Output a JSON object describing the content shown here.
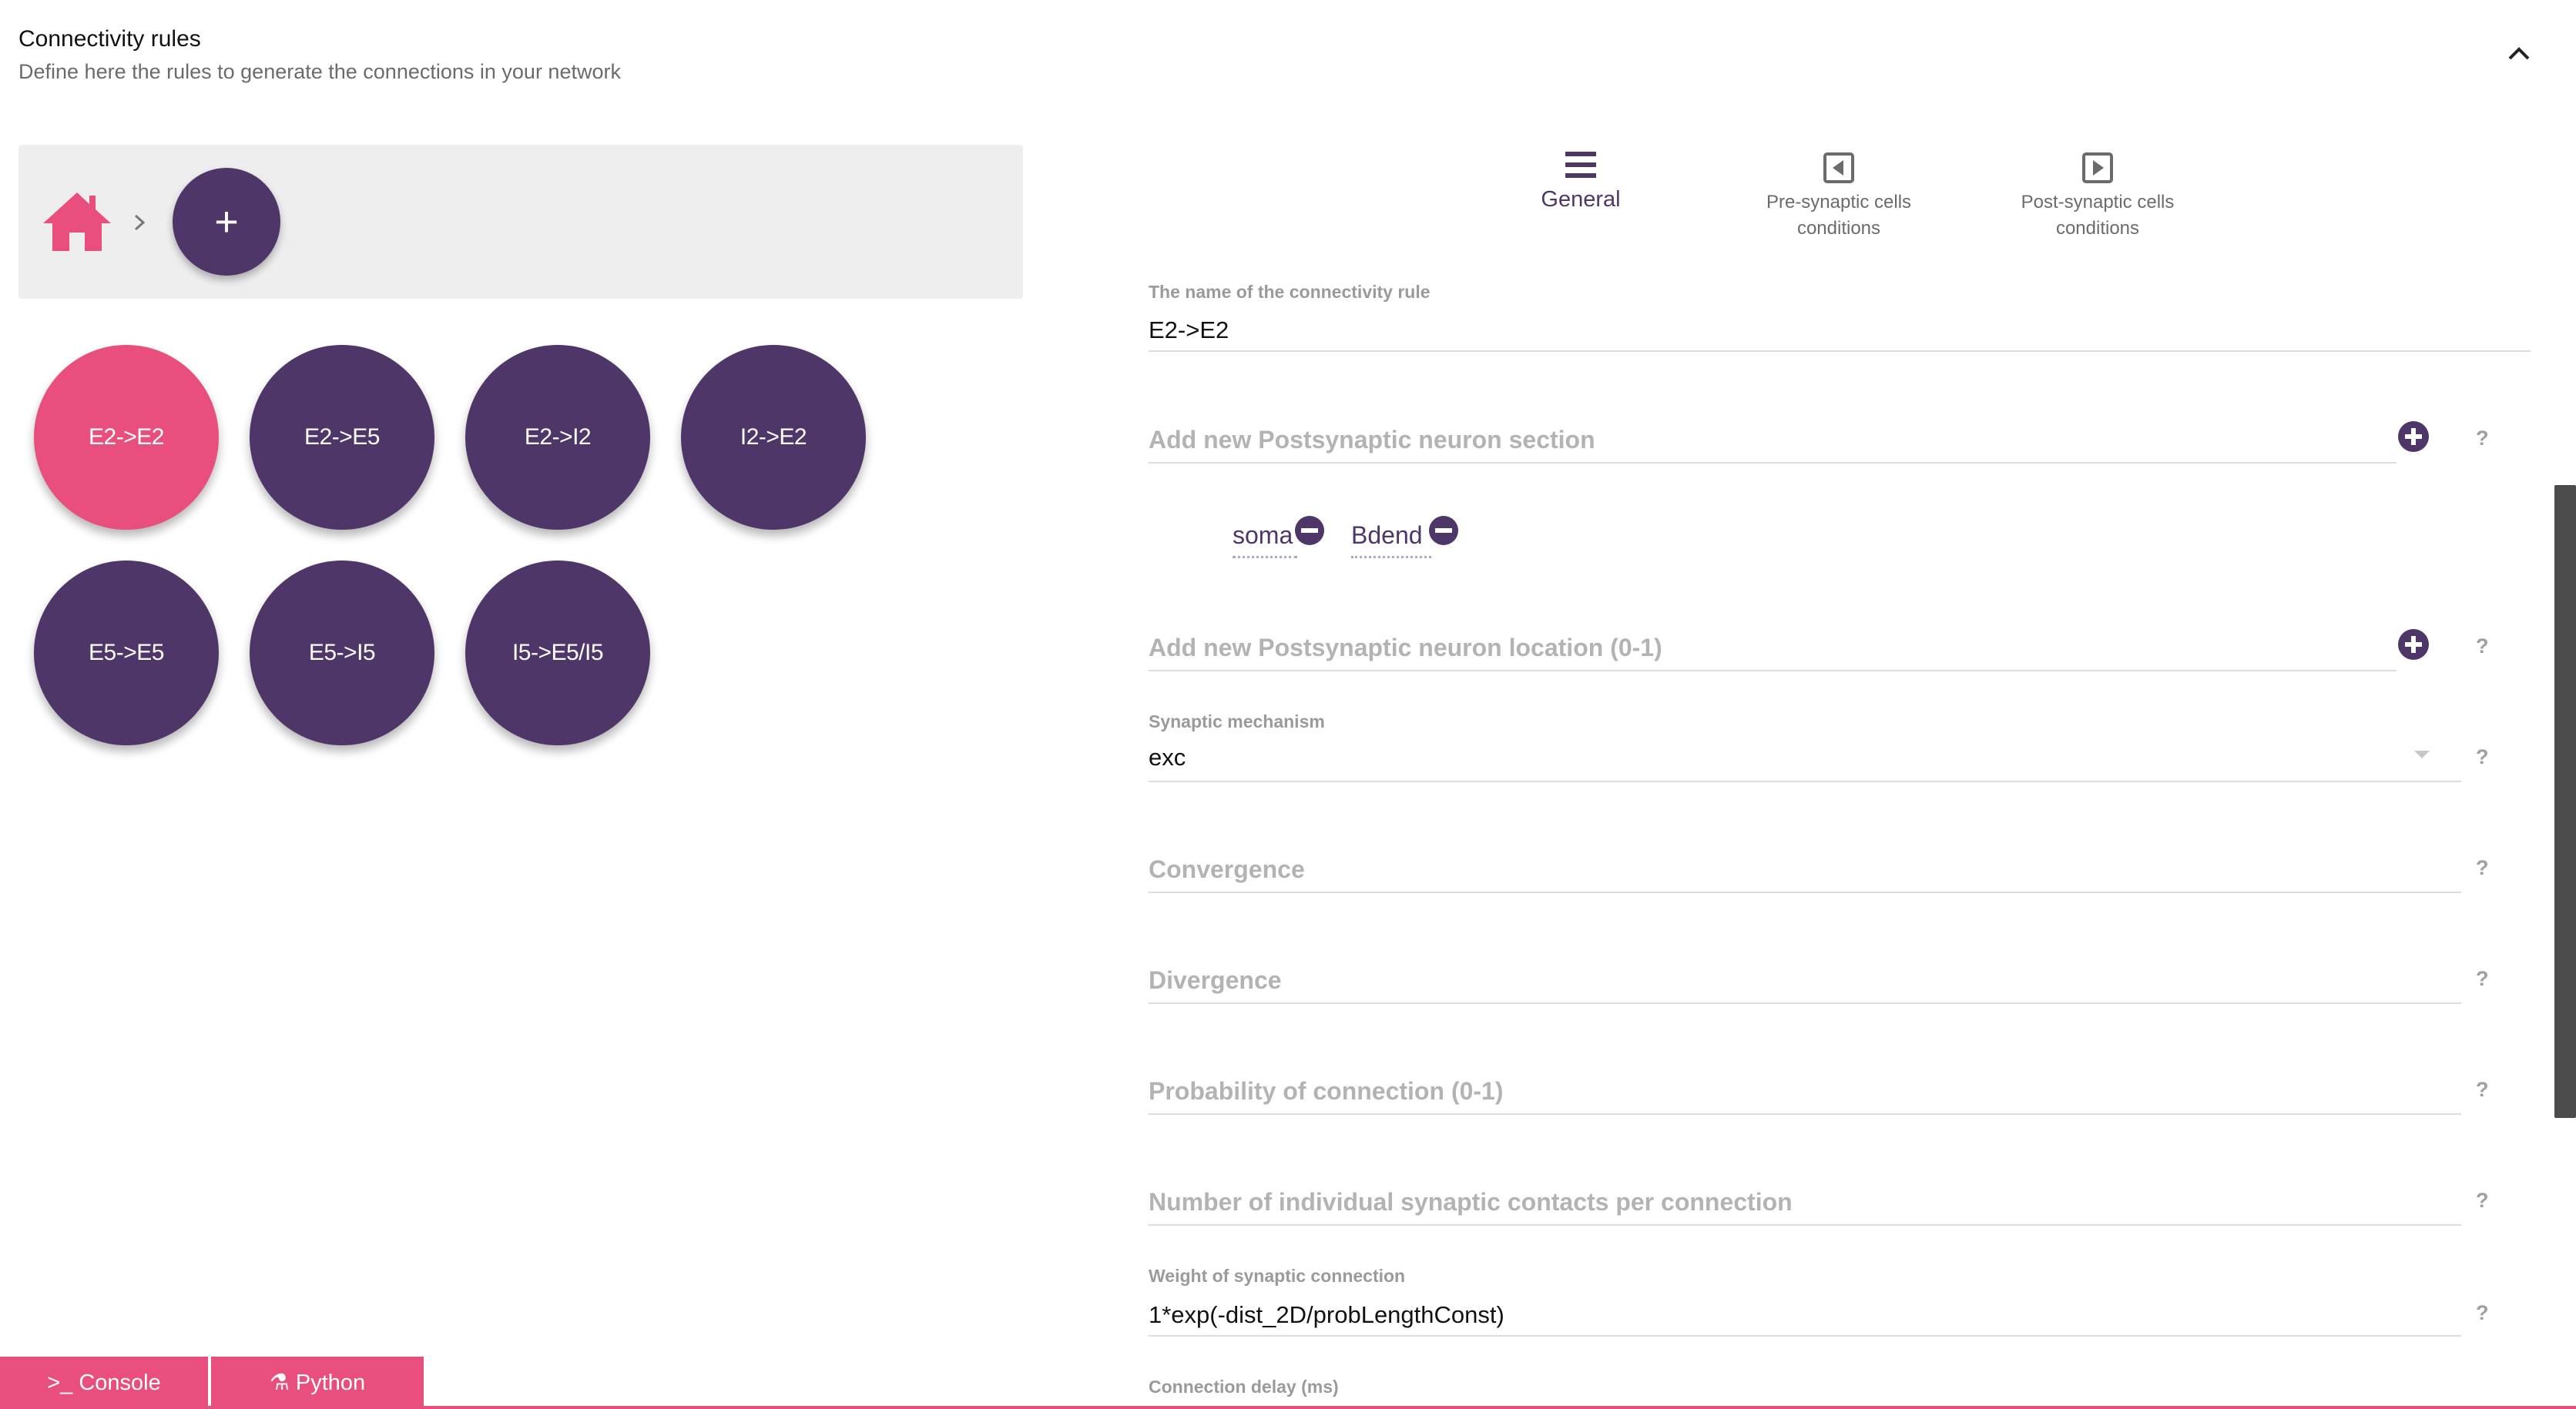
{
  "header": {
    "title": "Connectivity rules",
    "subtitle": "Define here the rules to generate the connections in your network"
  },
  "breadcrumb": {
    "add_label": "+"
  },
  "rules": [
    {
      "label": "E2->E2",
      "active": true
    },
    {
      "label": "E2->E5",
      "active": false
    },
    {
      "label": "E2->I2",
      "active": false
    },
    {
      "label": "I2->E2",
      "active": false
    },
    {
      "label": "E5->E5",
      "active": false
    },
    {
      "label": "E5->I5",
      "active": false
    },
    {
      "label": "I5->E5/I5",
      "active": false
    }
  ],
  "tabs": [
    {
      "label": "General",
      "icon": "menu-icon",
      "active": true
    },
    {
      "label": "Pre-synaptic cells\nconditions",
      "icon": "arrow-left-box-icon",
      "active": false
    },
    {
      "label": "Post-synaptic cells\nconditions",
      "icon": "arrow-right-box-icon",
      "active": false
    }
  ],
  "form": {
    "name": {
      "label": "The name of the connectivity rule",
      "value": "E2->E2"
    },
    "post_section": {
      "placeholder": "Add new Postsynaptic neuron section",
      "chips": [
        "soma",
        "Bdend"
      ]
    },
    "post_location": {
      "placeholder": "Add new Postsynaptic neuron location (0-1)"
    },
    "synaptic_mechanism": {
      "label": "Synaptic mechanism",
      "value": "exc"
    },
    "convergence": {
      "placeholder": "Convergence"
    },
    "divergence": {
      "placeholder": "Divergence"
    },
    "probability": {
      "placeholder": "Probability of connection (0-1)"
    },
    "contacts": {
      "placeholder": "Number of individual synaptic contacts per connection"
    },
    "weight": {
      "label": "Weight of synaptic connection",
      "value": "1*exp(-dist_2D/probLengthConst)"
    },
    "delay": {
      "label": "Connection delay (ms)"
    },
    "help": "?"
  },
  "bottom_tabs": {
    "console": ">_ Console",
    "python": "Python"
  },
  "colors": {
    "primary": "#4e3668",
    "accent": "#e84f7d"
  }
}
